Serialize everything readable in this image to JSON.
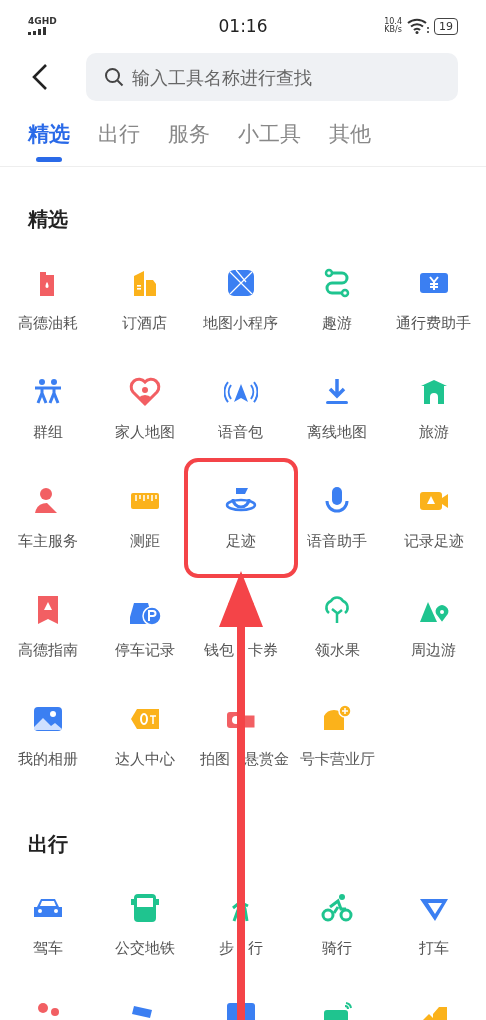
{
  "status_bar": {
    "network": "4GHD",
    "time": "01:16",
    "speed_value": "10.4",
    "speed_unit": "KB/s",
    "battery": "19"
  },
  "search": {
    "placeholder": "输入工具名称进行查找"
  },
  "tabs": [
    {
      "label": "精选",
      "selected": true
    },
    {
      "label": "出行",
      "selected": false
    },
    {
      "label": "服务",
      "selected": false
    },
    {
      "label": "小工具",
      "selected": false
    },
    {
      "label": "其他",
      "selected": false
    }
  ],
  "sections": [
    {
      "title": "精选",
      "items": [
        {
          "label": "高德油耗",
          "highlighted": false
        },
        {
          "label": "订酒店",
          "highlighted": false
        },
        {
          "label": "地图小程序",
          "highlighted": false
        },
        {
          "label": "趣游",
          "highlighted": false
        },
        {
          "label": "通行费助手",
          "highlighted": false
        },
        {
          "label": "群组",
          "highlighted": false
        },
        {
          "label": "家人地图",
          "highlighted": false
        },
        {
          "label": "语音包",
          "highlighted": false
        },
        {
          "label": "离线地图",
          "highlighted": false
        },
        {
          "label": "旅游",
          "highlighted": false
        },
        {
          "label": "车主服务",
          "highlighted": false
        },
        {
          "label": "测距",
          "highlighted": false
        },
        {
          "label": "足迹",
          "highlighted": true
        },
        {
          "label": "语音助手",
          "highlighted": false
        },
        {
          "label": "记录足迹",
          "highlighted": false
        },
        {
          "label": "高德指南",
          "highlighted": false
        },
        {
          "label": "停车记录",
          "highlighted": false
        },
        {
          "label_parts": [
            "钱包",
            "卡券"
          ],
          "highlighted": false
        },
        {
          "label": "领水果",
          "highlighted": false
        },
        {
          "label": "周边游",
          "highlighted": false
        },
        {
          "label": "我的相册",
          "highlighted": false
        },
        {
          "label": "达人中心",
          "highlighted": false
        },
        {
          "label_parts": [
            "拍图",
            "悬赏金"
          ],
          "highlighted": false
        },
        {
          "label": "号卡营业厅",
          "highlighted": false
        }
      ]
    },
    {
      "title": "出行",
      "items": [
        {
          "label": "驾车",
          "highlighted": false
        },
        {
          "label": "公交地铁",
          "highlighted": false
        },
        {
          "label_parts": [
            "步",
            "行"
          ],
          "highlighted": false
        },
        {
          "label": "骑行",
          "highlighted": false
        },
        {
          "label": "打车",
          "highlighted": false
        }
      ]
    }
  ]
}
